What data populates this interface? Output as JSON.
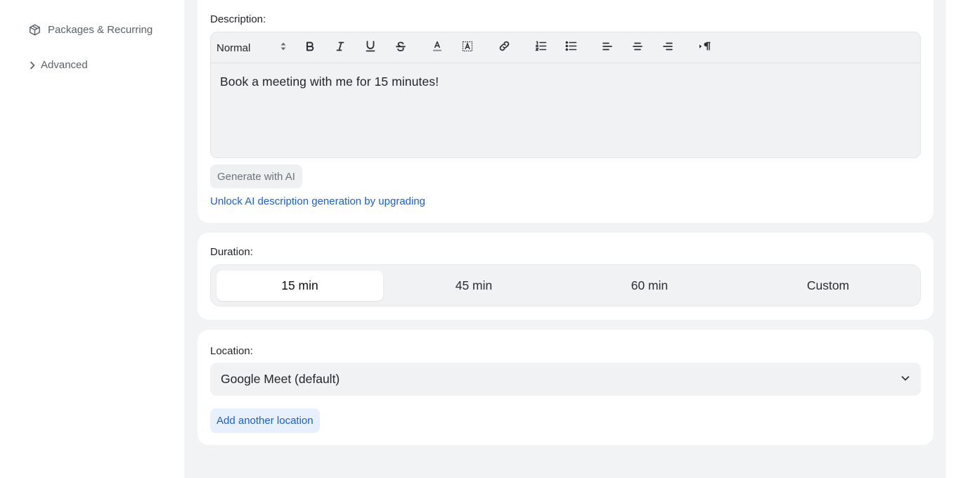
{
  "sidebar": {
    "partial_item": "…",
    "items": [
      {
        "label": "Packages & Recurring",
        "icon": "package-icon"
      },
      {
        "label": "Advanced",
        "icon": "chevron-right-icon"
      }
    ]
  },
  "description": {
    "label": "Description:",
    "format_value": "Normal",
    "toolbar": [
      "bold-icon",
      "italic-icon",
      "underline-icon",
      "strikethrough-icon",
      "text-color-icon",
      "highlight-icon",
      "link-icon",
      "ordered-list-icon",
      "bullet-list-icon",
      "align-left-icon",
      "align-center-icon",
      "align-right-icon",
      "text-direction-icon"
    ],
    "body_text": "Book a meeting with me for 15 minutes!",
    "generate_label": "Generate with AI",
    "upgrade_link": "Unlock AI description generation by upgrading"
  },
  "duration": {
    "label": "Duration:",
    "options": [
      "15 min",
      "45 min",
      "60 min",
      "Custom"
    ],
    "selected": "15 min"
  },
  "location": {
    "label": "Location:",
    "selected": "Google Meet (default)",
    "add_label": "Add another location"
  },
  "colors": {
    "page_bg": "#f2f3f5",
    "card_bg": "#ffffff",
    "link": "#1a5fd1",
    "field_bg": "#f1f2f4"
  }
}
